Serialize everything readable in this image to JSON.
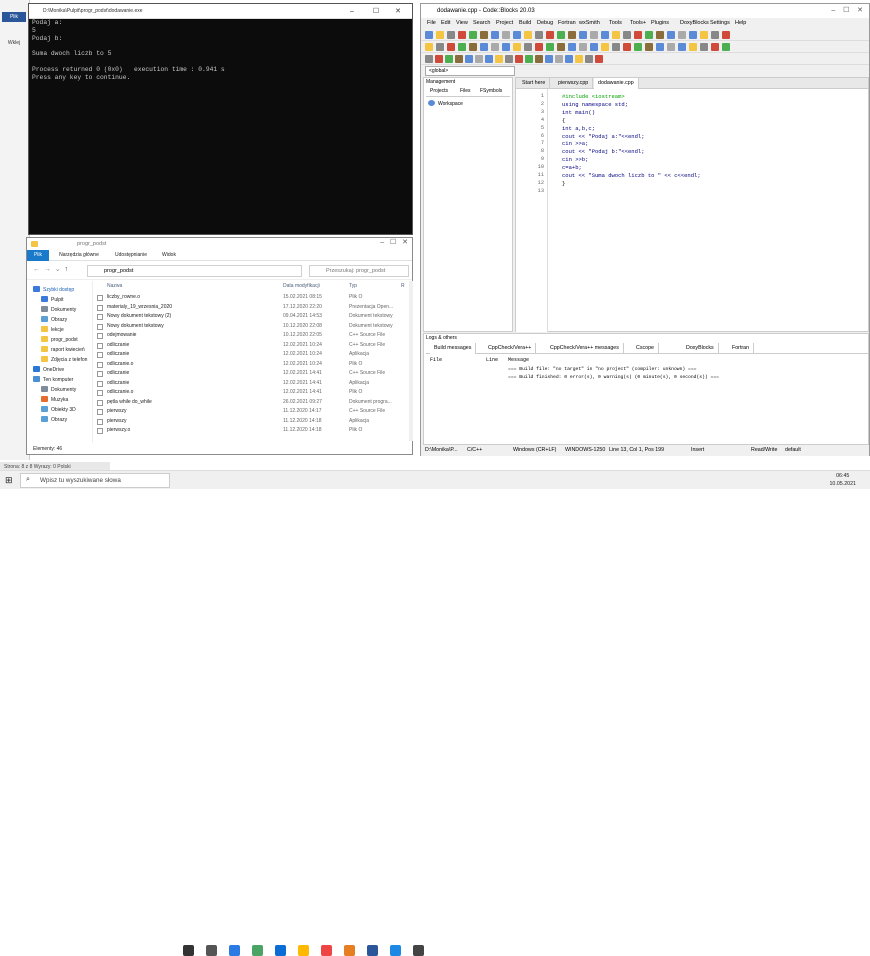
{
  "word": {
    "tab": "Plik",
    "button": "Wklej",
    "status": "Strona: 8 z 8   Wyrazy: 0   Polski"
  },
  "console": {
    "title": "D:\\Monika\\Pulpit\\progr_podst\\dodawanie.exe",
    "lines": [
      "Podaj a:",
      "5",
      "Podaj b:",
      "",
      "Suma dwoch liczb to 5",
      "",
      "Process returned 0 (0x0)   execution time : 0.941 s",
      "Press any key to continue."
    ]
  },
  "explorer": {
    "title": "progr_podst",
    "ribbon": [
      "Plik",
      "Narzędzia główne",
      "Udostępnianie",
      "Widok"
    ],
    "address": "progr_podst",
    "search_placeholder": "Przeszukaj: progr_podst",
    "nav": [
      "Szybki dostęp",
      "Pulpit",
      "Dokumenty",
      "Obrazy",
      "lekcje",
      "progr_podst",
      "raport kwiecień",
      "Zdjęcia z telefon",
      "OneDrive",
      "Ten komputer",
      "Dokumenty",
      "Muzyka",
      "Obiekty 3D",
      "Obrazy"
    ],
    "columns": {
      "name": "Nazwa",
      "date": "Data modyfikacji",
      "type": "Typ",
      "size": "R"
    },
    "rows": [
      {
        "name": "liczby_rowne.o",
        "date": "15.02.2021 08:15",
        "type": "Plik O"
      },
      {
        "name": "materialy_19_wrzesnia_2020",
        "date": "17.12.2020 22:20",
        "type": "Prezentacja Open..."
      },
      {
        "name": "Nowy dokument tekstowy (2)",
        "date": "09.04.2021 14:53",
        "type": "Dokument tekstowy"
      },
      {
        "name": "Nowy dokument tekstowy",
        "date": "10.12.2020 22:08",
        "type": "Dokument tekstowy"
      },
      {
        "name": "odejmowanie",
        "date": "10.12.2020 22:05",
        "type": "C++ Source File"
      },
      {
        "name": "odliczanie",
        "date": "12.02.2021 10:24",
        "type": "C++ Source File"
      },
      {
        "name": "odliczanie",
        "date": "12.02.2021 10:24",
        "type": "Aplikacja"
      },
      {
        "name": "odliczanie.o",
        "date": "12.02.2021 10:24",
        "type": "Plik O"
      },
      {
        "name": "odliczanie",
        "date": "12.02.2021 14:41",
        "type": "C++ Source File"
      },
      {
        "name": "odliczanie",
        "date": "12.02.2021 14:41",
        "type": "Aplikacja"
      },
      {
        "name": "odliczanie.o",
        "date": "12.02.2021 14:41",
        "type": "Plik O"
      },
      {
        "name": "pętla while do_while",
        "date": "26.02.2021 09:27",
        "type": "Dokument progra..."
      },
      {
        "name": "pierwszy",
        "date": "11.12.2020 14:17",
        "type": "C++ Source File"
      },
      {
        "name": "pierwszy",
        "date": "11.12.2020 14:18",
        "type": "Aplikacja"
      },
      {
        "name": "pierwszy.o",
        "date": "11.12.2020 14:18",
        "type": "Plik O"
      }
    ],
    "status": "Elementy: 46"
  },
  "codeblocks": {
    "title": "dodawanie.cpp - Code::Blocks 20.03",
    "menu": [
      "File",
      "Edit",
      "View",
      "Search",
      "Project",
      "Build",
      "Debug",
      "Fortran",
      "wxSmith",
      "Tools",
      "Tools+",
      "Plugins",
      "DoxyBlocks",
      "Settings",
      "Help"
    ],
    "global": "<global>",
    "management": {
      "title": "Management",
      "tabs": [
        "Projects",
        "Files",
        "FSymbols"
      ],
      "workspace": "Workspace"
    },
    "editor_tabs": [
      "Start here",
      "pierwszy.cpp",
      "dodawanie.cpp"
    ],
    "code": [
      {
        "n": "1",
        "t": "#include <iostream>",
        "c": "#00a000"
      },
      {
        "n": "2",
        "t": "using namespace std;",
        "c": "#000080"
      },
      {
        "n": "3",
        "t": "int main()",
        "c": "#000080"
      },
      {
        "n": "4",
        "t": "{",
        "c": "#000"
      },
      {
        "n": "5",
        "t": "int a,b,c;",
        "c": "#000080"
      },
      {
        "n": "6",
        "t": "cout << \"Podaj a:\"<<endl;",
        "c": "#000080"
      },
      {
        "n": "7",
        "t": "cin >>a;",
        "c": "#000080"
      },
      {
        "n": "8",
        "t": "cout << \"Podaj b:\"<<endl;",
        "c": "#000080"
      },
      {
        "n": "9",
        "t": "cin >>b;",
        "c": "#000080"
      },
      {
        "n": "10",
        "t": "c=a+b;",
        "c": "#000080"
      },
      {
        "n": "11",
        "t": "cout << \"Suma dwoch liczb to \" << c<<endl;",
        "c": "#000080"
      },
      {
        "n": "12",
        "t": "}",
        "c": "#000"
      },
      {
        "n": "13",
        "t": "",
        "c": "#000"
      }
    ],
    "logs": {
      "title": "Logs & others",
      "tabs": [
        "Build messages",
        "CppCheck/Vera++",
        "CppCheck/Vera++ messages",
        "Cscope",
        "DoxyBlocks",
        "Fortran"
      ],
      "cols": [
        "File",
        "Line",
        "Message"
      ],
      "messages": [
        "=== Build file: \"no target\" in \"no project\" (compiler: unknown) ===",
        "=== Build finished: 0 error(s), 0 warning(s) (0 minute(s), 0 second(s)) ==="
      ]
    },
    "status": [
      "D:\\Monika\\P...",
      "C/C++",
      "Windows (CR+LF)",
      "WINDOWS-1250",
      "Line 13, Col 1, Pos 199",
      "Insert",
      "Read/Write",
      "default"
    ]
  },
  "taskbar": {
    "search": "Wpisz tu wyszukiwane słowa",
    "time": "06:45",
    "date": "10.05.2021"
  }
}
